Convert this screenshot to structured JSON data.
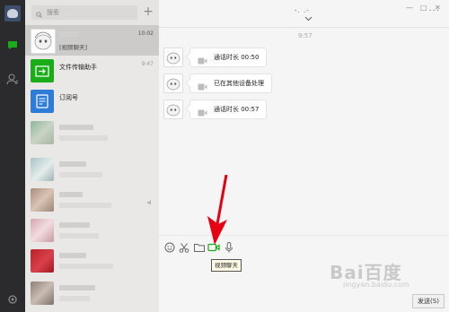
{
  "search": {
    "placeholder": "搜索"
  },
  "header": {
    "title": "-. .-",
    "more": "···",
    "controls": [
      "—",
      "□",
      "✕"
    ]
  },
  "chat_list": [
    {
      "name": "",
      "sub": "[视频聊天]",
      "time": "10:02",
      "active": true
    },
    {
      "name": "文件传输助手",
      "sub": "",
      "time": "9:47"
    },
    {
      "name": "订阅号",
      "sub": "",
      "time": ""
    }
  ],
  "conversation": {
    "timestamp": "9:57",
    "messages": [
      {
        "icon": "video-call-icon",
        "text": "通话时长 00:50"
      },
      {
        "icon": "video-call-icon",
        "text": "已在其他设备处理"
      },
      {
        "icon": "video-call-icon",
        "text": "通话时长 00:57"
      }
    ]
  },
  "toolbar": {
    "tooltip": "视频聊天",
    "send_label": "发送(S)",
    "accent": "#1aad19"
  },
  "watermark": {
    "text": "Bai百度",
    "sub": "jingyan.baidu.com"
  },
  "colors": {
    "accent": "#1aad19",
    "arrow": "#e60012"
  }
}
